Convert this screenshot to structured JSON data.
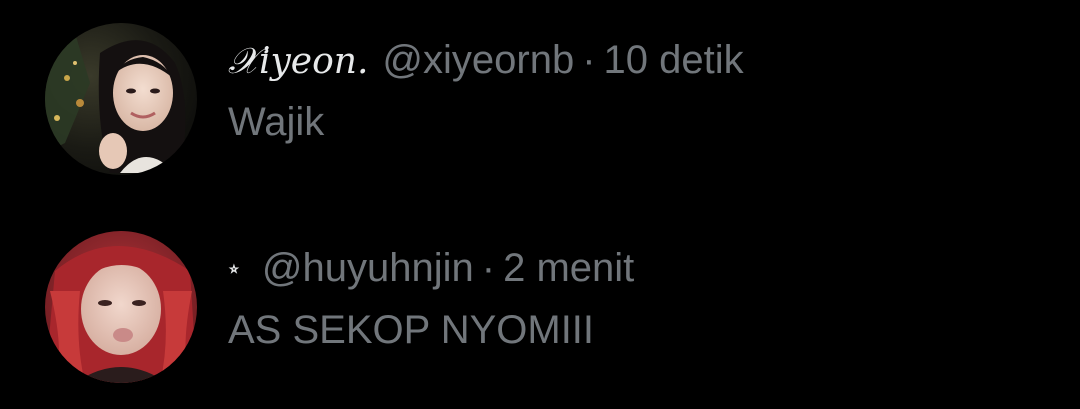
{
  "posts": [
    {
      "display_name": "𝒳iyeon.",
      "handle": "@xiyeornb",
      "separator": "·",
      "timestamp": "10 detik",
      "text": "Wajik"
    },
    {
      "display_name": "⭒",
      "handle": "@huyuhnjin",
      "separator": "·",
      "timestamp": "2 menit",
      "text": "AS SEKOP NYOMIII"
    }
  ],
  "colors": {
    "background": "#000000",
    "primary_text": "#e7e9ea",
    "secondary_text": "#71767b"
  }
}
